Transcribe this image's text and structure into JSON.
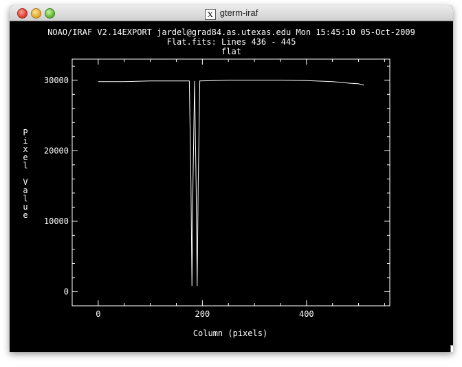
{
  "window": {
    "title": "gterm-iraf",
    "x_icon_label": "X"
  },
  "plot": {
    "header_line1": "NOAO/IRAF V2.14EXPORT jardel@grad84.as.utexas.edu Mon 15:45:10 05-Oct-2009",
    "header_line2": "Flat.fits: Lines 436 - 445",
    "header_line3": "flat"
  },
  "chart_data": {
    "type": "line",
    "xlabel": "Column (pixels)",
    "ylabel": "Pixel Value",
    "xlim": [
      -50,
      560
    ],
    "ylim": [
      -2000,
      33000
    ],
    "x_ticks": [
      0,
      200,
      400
    ],
    "y_ticks": [
      0,
      10000,
      20000,
      30000
    ],
    "series": [
      {
        "x": [
          0,
          50,
          100,
          150,
          175,
          178,
          180,
          182,
          185,
          188,
          190,
          192,
          195,
          250,
          300,
          350,
          400,
          450,
          480,
          500,
          510
        ],
        "values": [
          29800,
          29800,
          29900,
          29900,
          29900,
          15500,
          800,
          15500,
          29900,
          15000,
          800,
          15000,
          29900,
          30000,
          30000,
          30000,
          29950,
          29800,
          29600,
          29500,
          29300
        ]
      }
    ]
  }
}
